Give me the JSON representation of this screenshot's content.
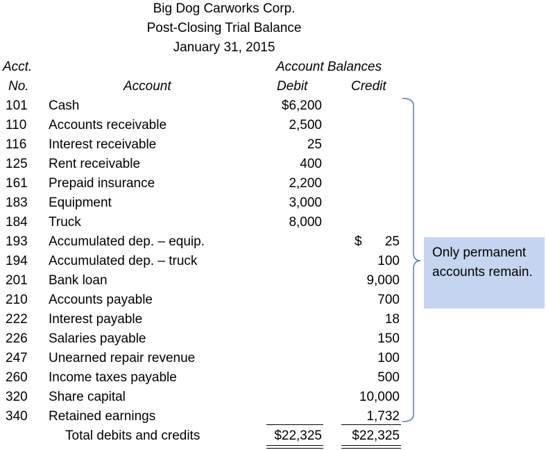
{
  "header": {
    "company": "Big Dog Carworks Corp.",
    "report": "Post-Closing Trial Balance",
    "date": "January 31, 2015"
  },
  "columns": {
    "acct_line1": "Acct.",
    "acct_line2": "No.",
    "account": "Account",
    "balances": "Account Balances",
    "debit": "Debit",
    "credit": "Credit"
  },
  "rows": [
    {
      "no": "101",
      "account": "Cash",
      "debit": "$6,200",
      "credit": ""
    },
    {
      "no": "110",
      "account": "Accounts receivable",
      "debit": "2,500",
      "credit": ""
    },
    {
      "no": "116",
      "account": "Interest receivable",
      "debit": "25",
      "credit": ""
    },
    {
      "no": "125",
      "account": "Rent receivable",
      "debit": "400",
      "credit": ""
    },
    {
      "no": "161",
      "account": "Prepaid insurance",
      "debit": "2,200",
      "credit": ""
    },
    {
      "no": "183",
      "account": "Equipment",
      "debit": "3,000",
      "credit": ""
    },
    {
      "no": "184",
      "account": "Truck",
      "debit": "8,000",
      "credit": ""
    },
    {
      "no": "193",
      "account": "Accumulated dep. – equip.",
      "debit": "",
      "credit": "25",
      "credit_prefix": "$"
    },
    {
      "no": "194",
      "account": "Accumulated dep. – truck",
      "debit": "",
      "credit": "100"
    },
    {
      "no": "201",
      "account": "Bank loan",
      "debit": "",
      "credit": "9,000"
    },
    {
      "no": "210",
      "account": "Accounts payable",
      "debit": "",
      "credit": "700"
    },
    {
      "no": "222",
      "account": "Interest payable",
      "debit": "",
      "credit": "18"
    },
    {
      "no": "226",
      "account": "Salaries payable",
      "debit": "",
      "credit": "150"
    },
    {
      "no": "247",
      "account": "Unearned repair revenue",
      "debit": "",
      "credit": "100"
    },
    {
      "no": "260",
      "account": "Income taxes payable",
      "debit": "",
      "credit": "500"
    },
    {
      "no": "320",
      "account": "Share capital",
      "debit": "",
      "credit": "10,000"
    },
    {
      "no": "340",
      "account": "Retained earnings",
      "debit": "",
      "credit": "1,732"
    }
  ],
  "totals": {
    "label": "Total debits and credits",
    "debit": "$22,325",
    "credit": "$22,325"
  },
  "callout": {
    "text": "Only permanent accounts remain."
  },
  "colors": {
    "callout_bg": "#c5d5ef",
    "bracket": "#4a7ebb"
  }
}
